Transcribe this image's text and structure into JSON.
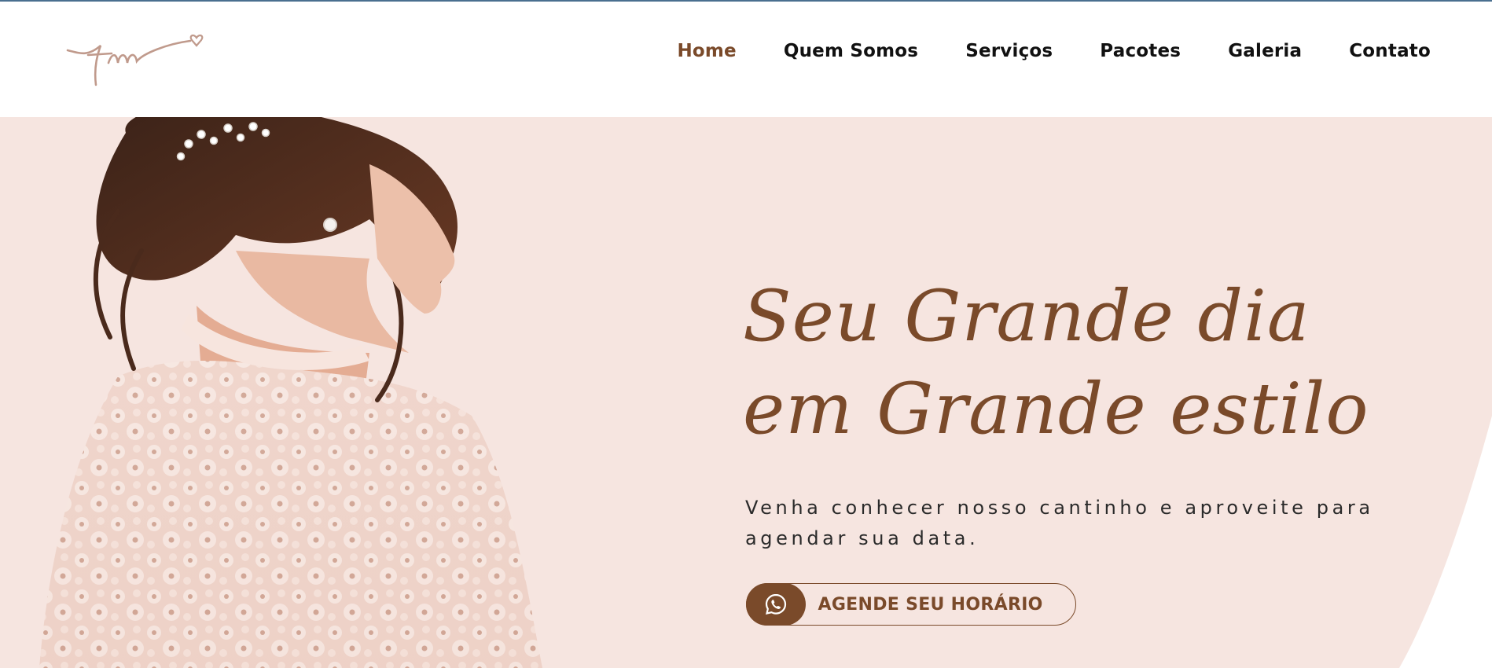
{
  "brand": {
    "logo_text": "fm"
  },
  "nav": {
    "items": [
      {
        "label": "Home",
        "active": true
      },
      {
        "label": "Quem Somos",
        "active": false
      },
      {
        "label": "Serviços",
        "active": false
      },
      {
        "label": "Pacotes",
        "active": false
      },
      {
        "label": "Galeria",
        "active": false
      },
      {
        "label": "Contato",
        "active": false
      }
    ]
  },
  "hero": {
    "headline_line1": "Seu Grande dia",
    "headline_line2": "em Grande estilo",
    "subtitle": "Venha conhecer nosso cantinho e aproveite para agendar sua data.",
    "cta_label": "AGENDE SEU HORÁRIO",
    "cta_icon": "whatsapp-icon"
  },
  "colors": {
    "accent": "#7a4a2a",
    "hero_bg": "#f6e5e0",
    "nav_text": "#111111"
  }
}
